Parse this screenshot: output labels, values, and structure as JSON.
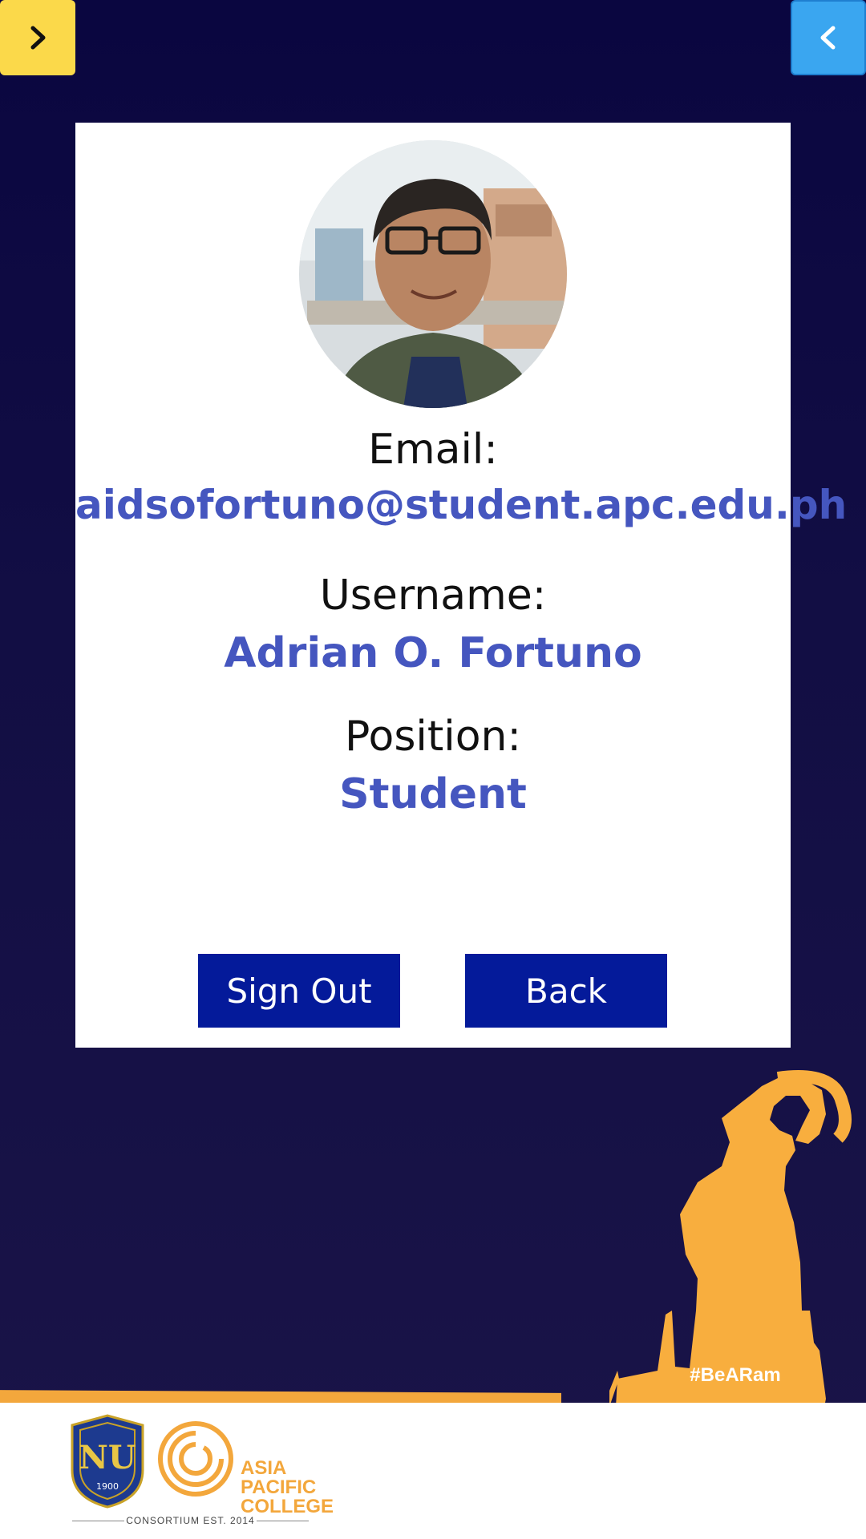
{
  "profile": {
    "email_label": "Email:",
    "email_value": "aidsofortuno@student.apc.edu.ph",
    "username_label": "Username:",
    "username_value": "Adrian O. Fortuno",
    "position_label": "Position:",
    "position_value": "Student"
  },
  "actions": {
    "sign_out_label": "Sign Out",
    "back_label": "Back"
  },
  "branding": {
    "hashtag": "#BeARam",
    "nu_year": "1900",
    "college_name_line1": "ASIA",
    "college_name_line2": "PACIFIC",
    "college_name_line3": "COLLEGE",
    "consortium": "CONSORTIUM EST. 2014"
  },
  "icons": {
    "forward": "chevron-right-icon",
    "back": "chevron-left-icon"
  },
  "colors": {
    "background": "#0a0640",
    "accent_yellow": "#fbd94a",
    "accent_blue": "#3aa6f0",
    "value_text": "#4556bf",
    "button_bg": "#041a9a",
    "brand_orange": "#f3a73c"
  }
}
